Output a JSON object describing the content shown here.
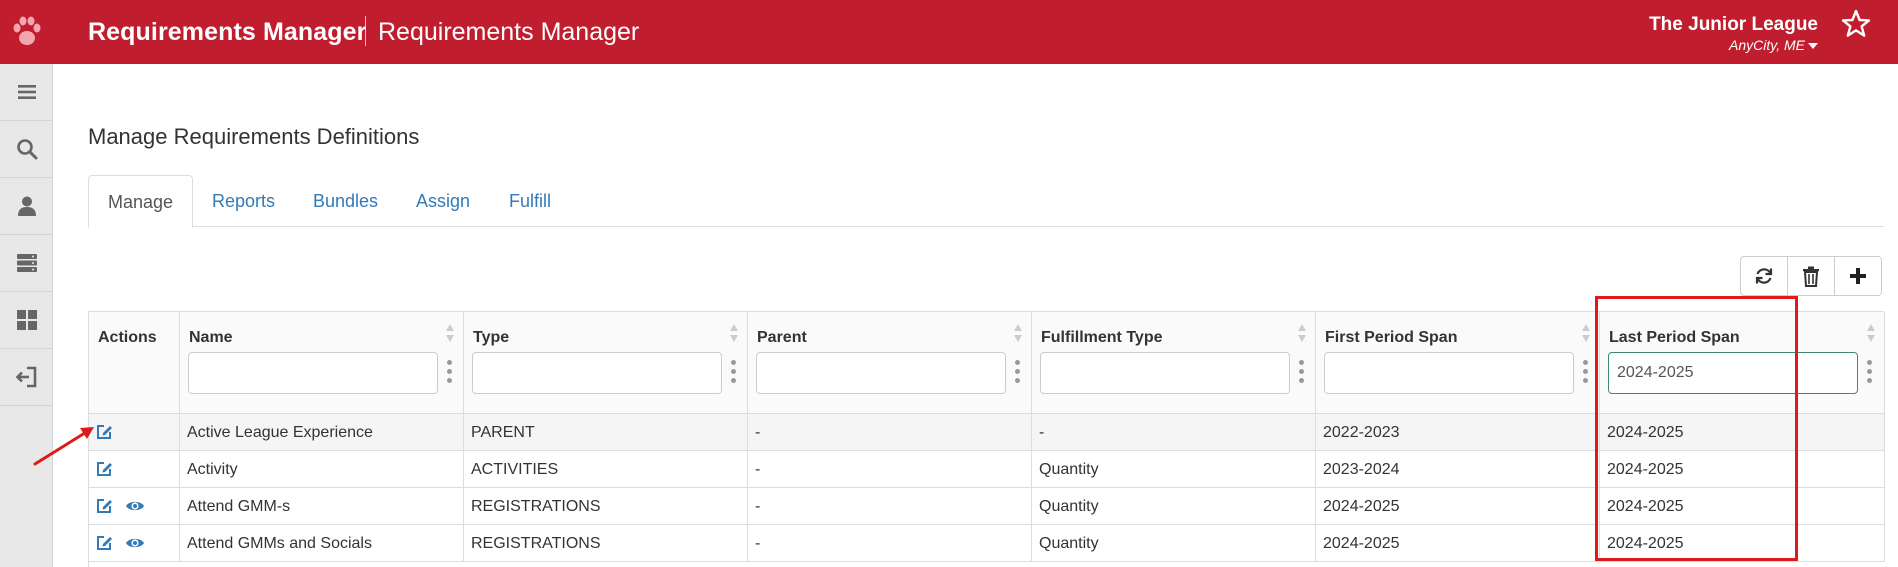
{
  "header": {
    "app_title": "Requirements Manager",
    "app_subtitle": "Requirements Manager",
    "org_name": "The Junior League",
    "org_city": "AnyCity, ME"
  },
  "sidebar": {
    "items": [
      {
        "icon": "menu-icon"
      },
      {
        "icon": "search-icon"
      },
      {
        "icon": "user-icon"
      },
      {
        "icon": "server-icon"
      },
      {
        "icon": "dashboard-icon"
      },
      {
        "icon": "sign-out-icon"
      }
    ]
  },
  "page": {
    "title": "Manage Requirements Definitions"
  },
  "tabs": [
    "Manage",
    "Reports",
    "Bundles",
    "Assign",
    "Fulfill"
  ],
  "active_tab": "Manage",
  "toolbar": {
    "buttons": [
      "refresh-icon",
      "trash-icon",
      "plus-icon"
    ]
  },
  "grid": {
    "columns": [
      "Actions",
      "Name",
      "Type",
      "Parent",
      "Fulfillment Type",
      "First Period Span",
      "Last Period Span"
    ],
    "filters": {
      "name": "",
      "type": "",
      "parent": "",
      "fulfillment_type": "",
      "first_period_span": "",
      "last_period_span": "2024-2025"
    },
    "rows": [
      {
        "name": "Active League Experience",
        "type": "PARENT",
        "parent": "-",
        "fulfillment": "-",
        "first": "2022-2023",
        "last": "2024-2025",
        "view": false
      },
      {
        "name": "Activity",
        "type": "ACTIVITIES",
        "parent": "-",
        "fulfillment": "Quantity",
        "first": "2023-2024",
        "last": "2024-2025",
        "view": false
      },
      {
        "name": "Attend GMM-s",
        "type": "REGISTRATIONS",
        "parent": "-",
        "fulfillment": "Quantity",
        "first": "2024-2025",
        "last": "2024-2025",
        "view": true
      },
      {
        "name": "Attend GMMs and Socials",
        "type": "REGISTRATIONS",
        "parent": "-",
        "fulfillment": "Quantity",
        "first": "2024-2025",
        "last": "2024-2025",
        "view": true
      }
    ]
  },
  "colors": {
    "brand": "#c01d2e",
    "link": "#337ab7",
    "annotation": "#e01a1a"
  }
}
